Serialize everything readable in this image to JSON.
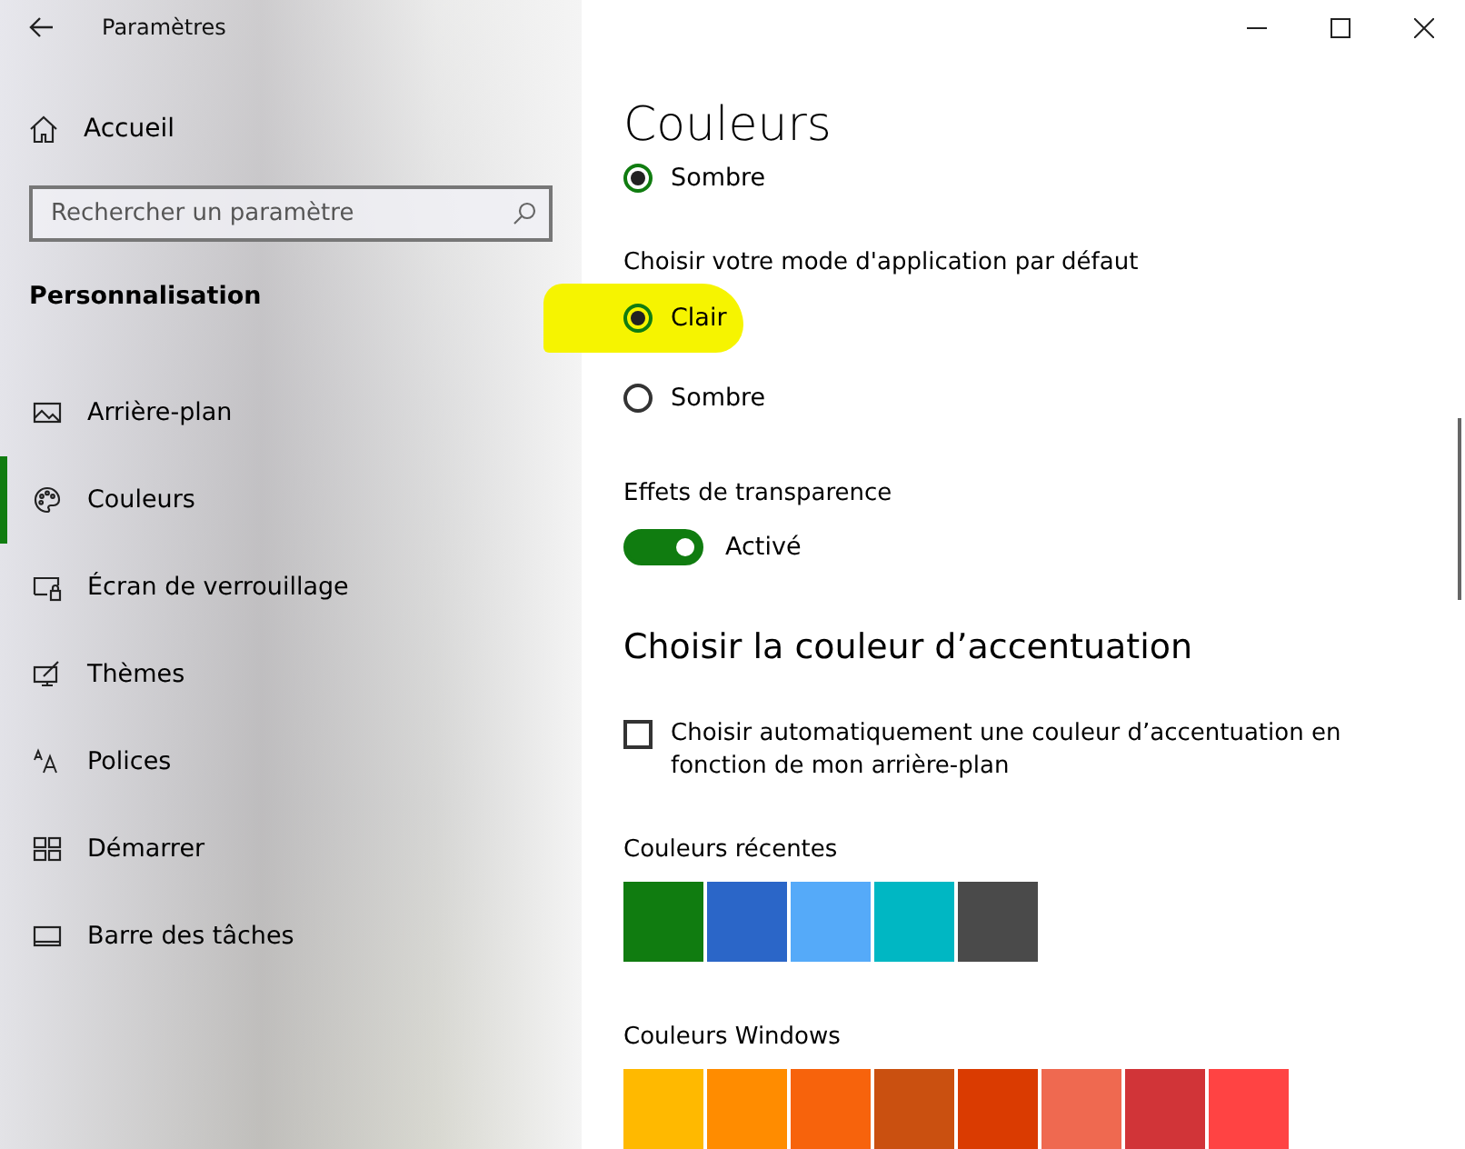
{
  "window": {
    "title": "Paramètres"
  },
  "sidebar": {
    "home": {
      "label": "Accueil"
    },
    "search": {
      "placeholder": "Rechercher un paramètre"
    },
    "section": "Personnalisation",
    "items": [
      {
        "label": "Arrière-plan",
        "kind": "image",
        "selected": false
      },
      {
        "label": "Couleurs",
        "kind": "palette",
        "selected": true
      },
      {
        "label": "Écran de verrouillage",
        "kind": "lock",
        "selected": false
      },
      {
        "label": "Thèmes",
        "kind": "themes",
        "selected": false
      },
      {
        "label": "Polices",
        "kind": "fonts",
        "selected": false
      },
      {
        "label": "Démarrer",
        "kind": "start",
        "selected": false
      },
      {
        "label": "Barre des tâches",
        "kind": "taskbar",
        "selected": false
      }
    ]
  },
  "main": {
    "title": "Couleurs",
    "windows_mode": {
      "label": "Sombre",
      "selected": true
    },
    "app_mode": {
      "label": "Choisir votre mode d'application par défaut",
      "options": [
        {
          "label": "Clair",
          "selected": true,
          "highlighted": true
        },
        {
          "label": "Sombre",
          "selected": false,
          "highlighted": false
        }
      ]
    },
    "transparency": {
      "label": "Effets de transparence",
      "on": true,
      "state_label": "Activé"
    },
    "accent_heading": "Choisir la couleur d’accentuation",
    "auto_accent": {
      "label": "Choisir automatiquement une couleur d’accentuation en fonction de mon arrière-plan",
      "checked": false
    },
    "recent_colors": {
      "label": "Couleurs récentes",
      "swatches": [
        {
          "color": "#107c10"
        },
        {
          "color": "#2b66c8"
        },
        {
          "color": "#55aaf9"
        },
        {
          "color": "#00b7c3"
        },
        {
          "color": "#4a4a4a"
        }
      ]
    },
    "windows_colors": {
      "label": "Couleurs Windows",
      "swatches": [
        {
          "color": "#ffb900"
        },
        {
          "color": "#ff8c00"
        },
        {
          "color": "#f7630c"
        },
        {
          "color": "#ca5010"
        },
        {
          "color": "#da3b01"
        },
        {
          "color": "#ef6950"
        },
        {
          "color": "#d13438"
        },
        {
          "color": "#ff4343"
        }
      ]
    }
  }
}
